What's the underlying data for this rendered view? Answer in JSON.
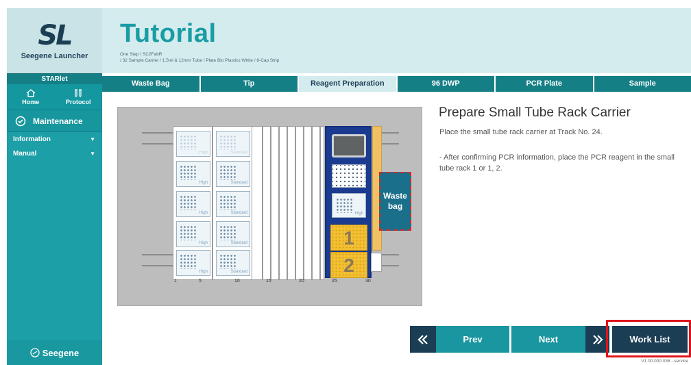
{
  "sidebar": {
    "logo_mark": "SL",
    "logo_text": "Seegene Launcher",
    "instrument": "STARlet",
    "nav": {
      "home": "Home",
      "protocol": "Protocol"
    },
    "maintenance": "Maintenance",
    "menu": [
      {
        "label": "Information"
      },
      {
        "label": "Manual"
      }
    ],
    "footer": "Seegene"
  },
  "header": {
    "title": "Tutorial",
    "subtitle_line1": "One Step / SC2FabR",
    "subtitle_line2": "/ 32 Sample Carrier / 1.5ml & 12mm Tube / Plate Bio Plastics White / 8-Cap Strip"
  },
  "tabs": [
    {
      "label": "Waste Bag",
      "active": false
    },
    {
      "label": "Tip",
      "active": false
    },
    {
      "label": "Reagent Preparation",
      "active": true
    },
    {
      "label": "96 DWP",
      "active": false
    },
    {
      "label": "PCR Plate",
      "active": false
    },
    {
      "label": "Sample",
      "active": false
    }
  ],
  "deck": {
    "plate_labels": {
      "high": "High",
      "standard": "Standard"
    },
    "dwp_label": "High",
    "racks": [
      "1",
      "2"
    ],
    "waste_bag": "Waste bag",
    "scale": [
      "1",
      "5",
      "10",
      "15",
      "20",
      "25",
      "30"
    ]
  },
  "instructions": {
    "title": "Prepare Small Tube Rack Carrier",
    "line1": "Place the small tube rack carrier at Track No. 24.",
    "line2": "- After confirming PCR information, place the PCR reagent in the small tube rack 1 or 1, 2."
  },
  "buttons": {
    "prev": "Prev",
    "next": "Next",
    "worklist": "Work List"
  },
  "version": "V1.00.000.036 - service",
  "colors": {
    "teal": "#1a9ca4",
    "navy": "#1b3e55",
    "highlight": "#e0141b"
  }
}
